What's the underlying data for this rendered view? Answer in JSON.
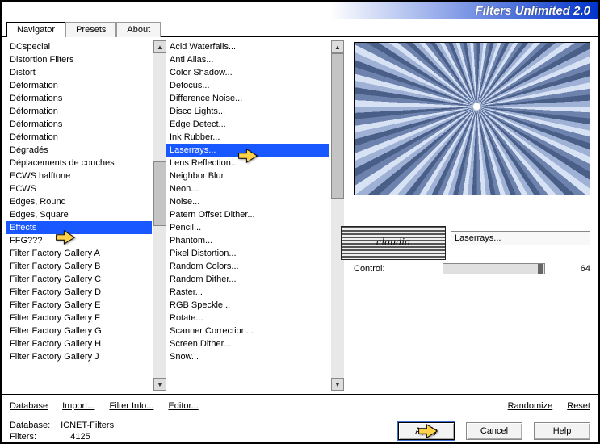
{
  "title": "Filters Unlimited 2.0",
  "tabs": [
    "Navigator",
    "Presets",
    "About"
  ],
  "active_tab": 0,
  "left_list": {
    "items": [
      "DCspecial",
      "Distortion Filters",
      "Distort",
      "Déformation",
      "Déformations",
      "Déformation",
      "Déformations",
      "Déformation",
      "Dégradés",
      "Déplacements de couches",
      "ECWS halftone",
      "ECWS",
      "Edges, Round",
      "Edges, Square",
      "Effects",
      "FFG???",
      "Filter Factory Gallery A",
      "Filter Factory Gallery B",
      "Filter Factory Gallery C",
      "Filter Factory Gallery D",
      "Filter Factory Gallery E",
      "Filter Factory Gallery F",
      "Filter Factory Gallery G",
      "Filter Factory Gallery H",
      "Filter Factory Gallery J"
    ],
    "selected_index": 14
  },
  "right_list": {
    "items": [
      "Acid Waterfalls...",
      "Anti Alias...",
      "Color Shadow...",
      "Defocus...",
      "Difference Noise...",
      "Disco Lights...",
      "Edge Detect...",
      "Ink Rubber...",
      "Laserrays...",
      "Lens Reflection...",
      "Neighbor Blur",
      "Neon...",
      "Noise...",
      "Patern Offset Dither...",
      "Pencil...",
      "Phantom...",
      "Pixel Distortion...",
      "Random Colors...",
      "Random Dither...",
      "Raster...",
      "RGB Speckle...",
      "Rotate...",
      "Scanner Correction...",
      "Screen Dither...",
      "Snow..."
    ],
    "selected_index": 8
  },
  "preview": {
    "filter_name": "Laserrays...",
    "control_label": "Control:",
    "control_value": "64"
  },
  "buttons": {
    "database": "Database",
    "import": "Import...",
    "filter_info": "Filter Info...",
    "editor": "Editor...",
    "randomize": "Randomize",
    "reset": "Reset",
    "apply": "Apply",
    "cancel": "Cancel",
    "help": "Help"
  },
  "status": {
    "db_label": "Database:",
    "db_value": "ICNET-Filters",
    "filters_label": "Filters:",
    "filters_value": "4125"
  },
  "watermark": "claudia"
}
